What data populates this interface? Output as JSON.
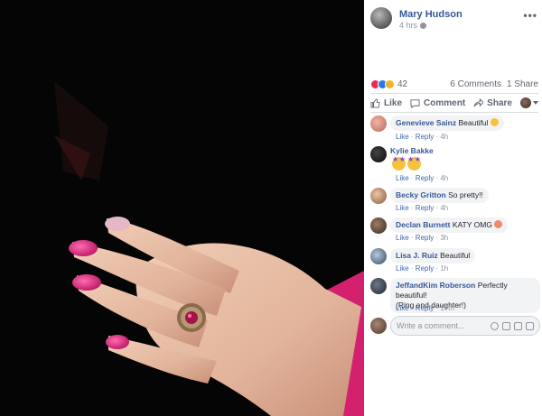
{
  "post": {
    "author": "Mary Hudson",
    "time": "4 hrs",
    "more": "•••"
  },
  "reactions": {
    "count": "42",
    "comments": "6 Comments",
    "shares": "1 Share"
  },
  "actions": {
    "like": "Like",
    "comment": "Comment",
    "share": "Share"
  },
  "comments": [
    {
      "name": "Genevieve Sainz",
      "text": "Beautiful",
      "like": "Like",
      "reply": "Reply",
      "time": "4h"
    },
    {
      "name": "Kylie Bakke",
      "text": "",
      "like": "Like",
      "reply": "Reply",
      "time": "4h"
    },
    {
      "name": "Becky Gritton",
      "text": "So pretty!!",
      "like": "Like",
      "reply": "Reply",
      "time": "4h"
    },
    {
      "name": "Declan Burnett",
      "text": "KATY OMG",
      "like": "Like",
      "reply": "Reply",
      "time": "3h"
    },
    {
      "name": "Lisa J. Ruiz",
      "text": "Beautiful",
      "like": "Like",
      "reply": "Reply",
      "time": "1h"
    },
    {
      "name": "JeffandKim Roberson",
      "text": "Perfectly beautiful!",
      "text2": "(Ring and daughter!)",
      "like": "Like",
      "reply": "Reply",
      "time": "17m"
    }
  ],
  "composer": {
    "placeholder": "Write a comment..."
  },
  "colors": {
    "link": "#365899",
    "nail": "#e0247a",
    "skin": "#e8bfa8"
  }
}
